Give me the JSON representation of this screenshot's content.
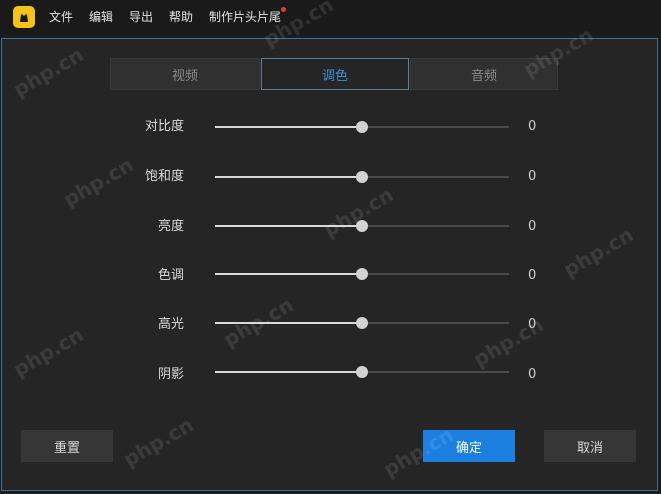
{
  "menubar": {
    "items": [
      "文件",
      "编辑",
      "导出",
      "帮助",
      "制作片头片尾"
    ],
    "logo_icon": "app-logo-icon",
    "notification_color": "#e53935"
  },
  "tabs": [
    {
      "label": "视频",
      "active": false
    },
    {
      "label": "调色",
      "active": true
    },
    {
      "label": "音频",
      "active": false
    }
  ],
  "sliders": [
    {
      "label": "对比度",
      "value": "0",
      "level": 0.5
    },
    {
      "label": "饱和度",
      "value": "0",
      "level": 0.5
    },
    {
      "label": "亮度",
      "value": "0",
      "level": 0.5
    },
    {
      "label": "色调",
      "value": "0",
      "level": 0.5
    },
    {
      "label": "高光",
      "value": "0",
      "level": 0.5
    },
    {
      "label": "阴影",
      "value": "0",
      "level": 0.5
    }
  ],
  "buttons": {
    "reset": "重置",
    "confirm": "确定",
    "cancel": "取消"
  },
  "watermark": "php.cn",
  "colors": {
    "accent": "#1b7fe0",
    "active_tab_text": "#3d8fd6",
    "logo": "#f4c21b"
  }
}
